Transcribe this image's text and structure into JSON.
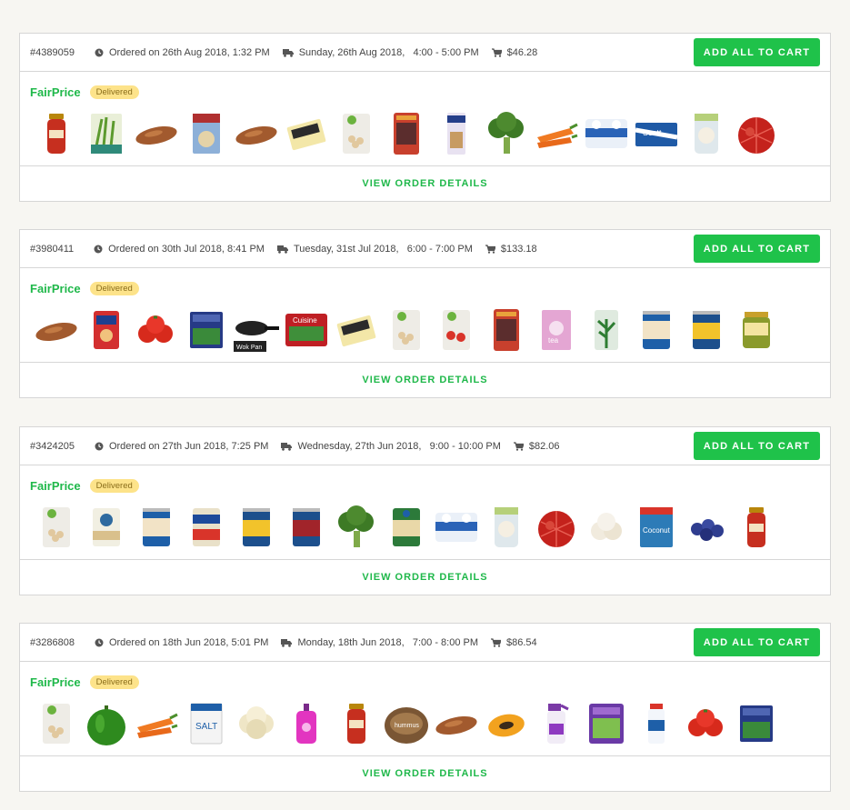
{
  "orders": [
    {
      "id": "#4389059",
      "ordered": "Ordered on 26th Aug 2018, 1:32 PM",
      "delivery": "Sunday, 26th Aug 2018,   4:00 - 5:00 PM",
      "total": "$46.28",
      "button_label": "ADD ALL TO CART",
      "store": "FairPrice",
      "status": "Delivered",
      "view_label": "VIEW ORDER DETAILS",
      "items": [
        "pasta-sauce-jar",
        "spring-onion-pack",
        "sweet-potato",
        "cereal-box",
        "sweet-potato",
        "frozen-food-box",
        "chickpea-pack",
        "snack-bag",
        "biscuit-pack",
        "broccoli",
        "carrots",
        "paper-towels",
        "scott-tissue",
        "garlic-pack",
        "red-onion-net"
      ]
    },
    {
      "id": "#3980411",
      "ordered": "Ordered on 30th Jul 2018, 8:41 PM",
      "delivery": "Tuesday, 31st Jul 2018,   6:00 - 7:00 PM",
      "total": "$133.18",
      "button_label": "ADD ALL TO CART",
      "store": "FairPrice",
      "status": "Delivered",
      "view_label": "VIEW ORDER DETAILS",
      "items": [
        "sweet-potato",
        "snack-bag-red",
        "tomatoes",
        "frozen-spinach",
        "wok-pan",
        "frozen-veg-bag",
        "frozen-food-box",
        "chickpea-pack",
        "tomato-pack",
        "snack-bag",
        "pink-tea-box",
        "herb-pack",
        "chickpea-can",
        "corn-can",
        "olive-jar"
      ]
    },
    {
      "id": "#3424205",
      "ordered": "Ordered on 27th Jun 2018, 7:25 PM",
      "delivery": "Wednesday, 27th Jun 2018,   9:00 - 10:00 PM",
      "total": "$82.06",
      "button_label": "ADD ALL TO CART",
      "store": "FairPrice",
      "status": "Delivered",
      "view_label": "VIEW ORDER DETAILS",
      "items": [
        "chickpea-pack",
        "beans-can",
        "chickpea-can",
        "baked-beans-can",
        "corn-can",
        "kidney-beans-can",
        "broccoli",
        "chickpea-can-green",
        "paper-towels",
        "garlic-pack",
        "red-onion-net",
        "garlic-bulbs",
        "coconut-milk-box",
        "blueberries",
        "pasta-sauce-jar"
      ]
    },
    {
      "id": "#3286808",
      "ordered": "Ordered on 18th Jun 2018, 5:01 PM",
      "delivery": "Monday, 18th Jun 2018,   7:00 - 8:00 PM",
      "total": "$86.54",
      "button_label": "ADD ALL TO CART",
      "store": "FairPrice",
      "status": "Delivered",
      "view_label": "VIEW ORDER DETAILS",
      "items": [
        "chickpea-pack",
        "green-pepper",
        "carrots",
        "salt-bag",
        "cauliflower",
        "hand-soap",
        "pasta-sauce-jar",
        "hummus-tub",
        "sweet-potato",
        "papaya",
        "spray-cleaner",
        "frozen-veg-purple",
        "salt-shaker",
        "tomatoes",
        "frozen-spinach"
      ]
    }
  ]
}
